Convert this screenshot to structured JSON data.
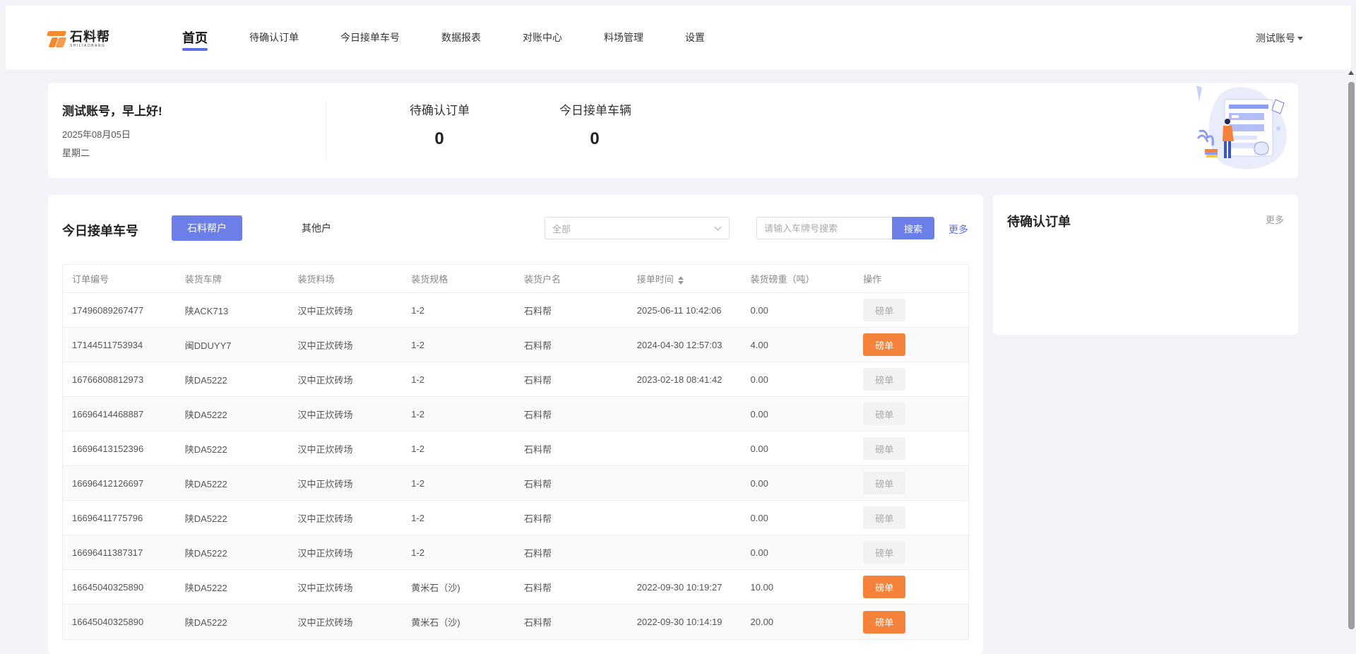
{
  "brand": {
    "name_cn": "石料帮",
    "name_en": "SHILIAOBANG",
    "accent": "#f28a2e"
  },
  "nav": {
    "items": [
      {
        "label": "首页",
        "active": true
      },
      {
        "label": "待确认订单"
      },
      {
        "label": "今日接单车号"
      },
      {
        "label": "数据报表"
      },
      {
        "label": "对账中心"
      },
      {
        "label": "料场管理"
      },
      {
        "label": "设置"
      }
    ],
    "account": "测试账号"
  },
  "welcome": {
    "greeting": "测试账号，早上好!",
    "date": "2025年08月05日",
    "weekday": "星期二",
    "stats": [
      {
        "label": "待确认订单",
        "value": "0"
      },
      {
        "label": "今日接单车辆",
        "value": "0"
      }
    ]
  },
  "today": {
    "title": "今日接单车号",
    "tabs": [
      "石料帮户",
      "其他户"
    ],
    "filter": {
      "value": "全部"
    },
    "search": {
      "placeholder": "请输入车牌号搜索",
      "button": "搜索"
    },
    "more": "更多",
    "columns": [
      "订单编号",
      "装货车牌",
      "装货料场",
      "装货规格",
      "装货户名",
      "接单时间",
      "装货磅重（吨）",
      "操作"
    ],
    "action_label": "磅单",
    "rows": [
      {
        "id": "17496089267477",
        "plate": "陕ACK713",
        "yard": "汉中正炊砖场",
        "spec": "1-2",
        "owner": "石料帮",
        "time": "2025-06-11 10:42:06",
        "weight": "0.00",
        "action_enabled": false
      },
      {
        "id": "17144511753934",
        "plate": "闽DDUYY7",
        "yard": "汉中正炊砖场",
        "spec": "1-2",
        "owner": "石料帮",
        "time": "2024-04-30 12:57:03",
        "weight": "4.00",
        "action_enabled": true
      },
      {
        "id": "16766808812973",
        "plate": "陕DA5222",
        "yard": "汉中正炊砖场",
        "spec": "1-2",
        "owner": "石料帮",
        "time": "2023-02-18 08:41:42",
        "weight": "0.00",
        "action_enabled": false
      },
      {
        "id": "16696414468887",
        "plate": "陕DA5222",
        "yard": "汉中正炊砖场",
        "spec": "1-2",
        "owner": "石料帮",
        "time": "",
        "weight": "0.00",
        "action_enabled": false
      },
      {
        "id": "16696413152396",
        "plate": "陕DA5222",
        "yard": "汉中正炊砖场",
        "spec": "1-2",
        "owner": "石料帮",
        "time": "",
        "weight": "0.00",
        "action_enabled": false
      },
      {
        "id": "16696412126697",
        "plate": "陕DA5222",
        "yard": "汉中正炊砖场",
        "spec": "1-2",
        "owner": "石料帮",
        "time": "",
        "weight": "0.00",
        "action_enabled": false
      },
      {
        "id": "16696411775796",
        "plate": "陕DA5222",
        "yard": "汉中正炊砖场",
        "spec": "1-2",
        "owner": "石料帮",
        "time": "",
        "weight": "0.00",
        "action_enabled": false
      },
      {
        "id": "16696411387317",
        "plate": "陕DA5222",
        "yard": "汉中正炊砖场",
        "spec": "1-2",
        "owner": "石料帮",
        "time": "",
        "weight": "0.00",
        "action_enabled": false
      },
      {
        "id": "16645040325890",
        "plate": "陕DA5222",
        "yard": "汉中正炊砖场",
        "spec": "黄米石（沙)",
        "owner": "石料帮",
        "time": "2022-09-30 10:19:27",
        "weight": "10.00",
        "action_enabled": true
      },
      {
        "id": "16645040325890",
        "plate": "陕DA5222",
        "yard": "汉中正炊砖场",
        "spec": "黄米石（沙)",
        "owner": "石料帮",
        "time": "2022-09-30 10:14:19",
        "weight": "20.00",
        "action_enabled": true
      }
    ]
  },
  "pending": {
    "title": "待确认订单",
    "more": "更多"
  },
  "colors": {
    "primary": "#6c7ee8",
    "action": "#f5823a",
    "background": "#f2f4f9"
  }
}
